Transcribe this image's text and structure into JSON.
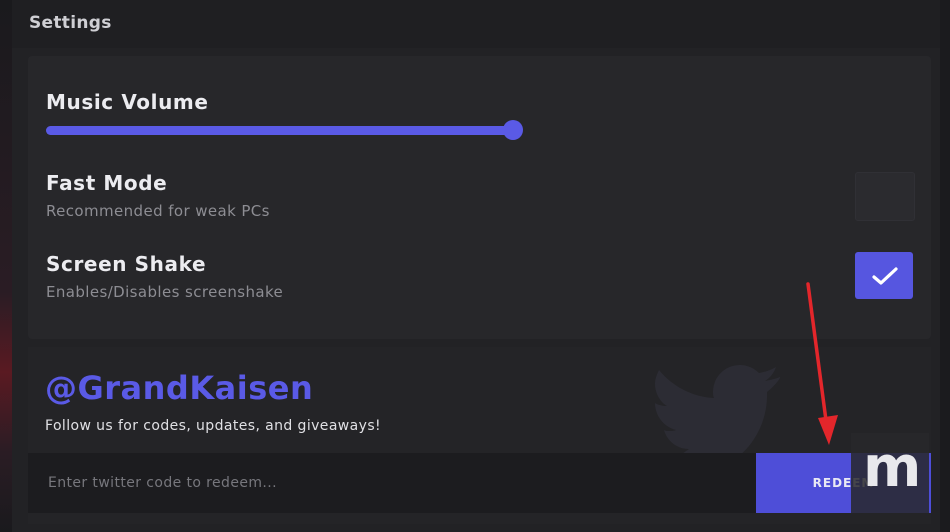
{
  "header": {
    "title": "Settings"
  },
  "settings": {
    "music_volume": {
      "label": "Music Volume",
      "level_percent": 100
    },
    "fast_mode": {
      "label": "Fast Mode",
      "description": "Recommended for weak PCs",
      "checked": false
    },
    "screen_shake": {
      "label": "Screen Shake",
      "description": "Enables/Disables screenshake",
      "checked": true
    }
  },
  "social": {
    "handle": "@GrandKaisen",
    "follow_text": "Follow us for codes, updates, and giveaways!",
    "code_input": {
      "placeholder": "Enter twitter code to redeem...",
      "value": ""
    },
    "redeem_label": "REDEEM"
  },
  "watermark": {
    "letter": "m"
  },
  "colors": {
    "accent": "#5a5ae6",
    "background": "#222225",
    "panel": "#27272a",
    "annotation_arrow": "#e3262b"
  },
  "icons": {
    "checkmark": "check-icon",
    "twitter_bird": "twitter-bird-icon",
    "annotation": "red-arrow-icon"
  }
}
